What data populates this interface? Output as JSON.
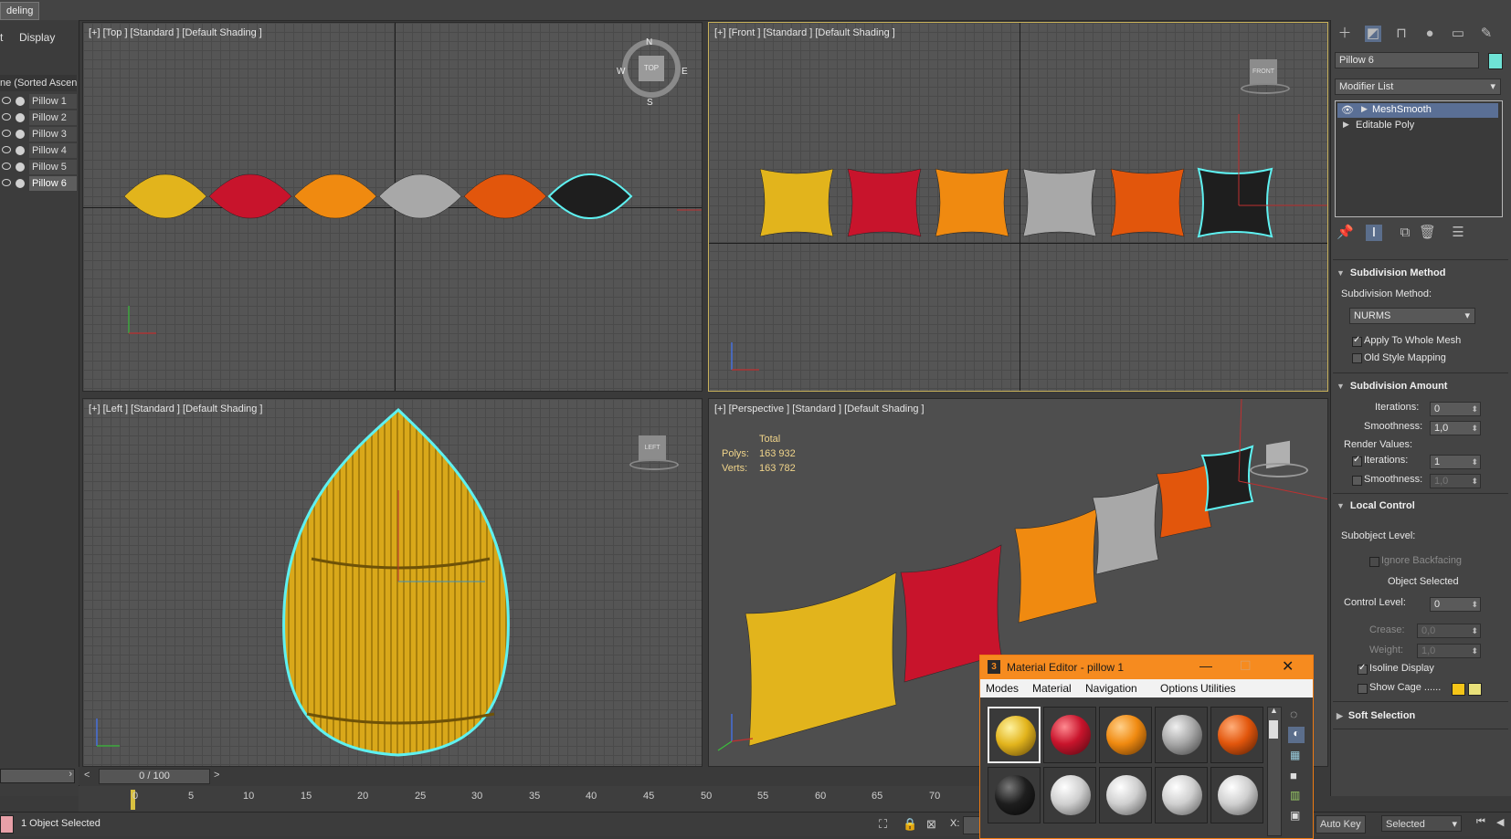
{
  "ribbon": {
    "tab_label": "deling"
  },
  "explorer": {
    "tabs": [
      "t",
      "Display"
    ],
    "sort_header": "ne (Sorted Ascen",
    "items": [
      "Pillow 1",
      "Pillow 2",
      "Pillow 3",
      "Pillow 4",
      "Pillow 5",
      "Pillow 6"
    ],
    "selected": "Pillow 6"
  },
  "viewports": {
    "top": {
      "label": "[+] [Top ] [Standard ] [Default Shading ]",
      "compass": {
        "n": "N",
        "s": "S",
        "e": "E",
        "w": "W",
        "cube": "TOP"
      }
    },
    "front": {
      "label": "[+] [Front ] [Standard ] [Default Shading ]",
      "cube": "FRONT"
    },
    "left": {
      "label": "[+] [Left ] [Standard ] [Default Shading ]",
      "cube": "LEFT"
    },
    "perspective": {
      "label": "[+] [Perspective ] [Standard ] [Default Shading ]",
      "stats": {
        "header": "Total",
        "polys_label": "Polys:",
        "polys": "163 932",
        "verts_label": "Verts:",
        "verts": "163 782"
      }
    }
  },
  "pillow_colors": [
    "#e2b41c",
    "#c8142c",
    "#f08a10",
    "#a8a8a8",
    "#e2560c",
    "#1e1e1e"
  ],
  "command_panel": {
    "object_name": "Pillow 6",
    "object_color": "#6fe3d6",
    "modifier_list": "Modifier List",
    "stack": [
      "MeshSmooth",
      "Editable Poly"
    ],
    "subdivision_method": {
      "title": "Subdivision Method",
      "method_label": "Subdivision Method:",
      "method_value": "NURMS",
      "apply_whole_mesh": "Apply To Whole Mesh",
      "old_style_mapping": "Old Style Mapping"
    },
    "subdivision_amount": {
      "title": "Subdivision Amount",
      "iterations_label": "Iterations:",
      "iterations": "0",
      "smoothness_label": "Smoothness:",
      "smoothness": "1,0",
      "render_values": "Render Values:",
      "render_iterations_label": "Iterations:",
      "render_iterations": "1",
      "render_smoothness_label": "Smoothness:",
      "render_smoothness": "1,0"
    },
    "local_control": {
      "title": "Local Control",
      "subobject_level": "Subobject Level:",
      "ignore_backfacing": "Ignore Backfacing",
      "object_selected": "Object Selected",
      "control_level_label": "Control Level:",
      "control_level": "0",
      "crease_label": "Crease:",
      "crease": "0,0",
      "weight_label": "Weight:",
      "weight": "1,0",
      "isoline_display": "Isoline Display",
      "show_cage": "Show Cage ......",
      "cage_colors": [
        "#f5c518",
        "#e8e07a"
      ]
    },
    "soft_selection": {
      "title": "Soft Selection"
    }
  },
  "material_editor": {
    "title": "Material Editor - pillow 1",
    "menu": [
      "Modes",
      "Material",
      "Navigation",
      "Options",
      "Utilities"
    ],
    "slot_colors_row1": [
      "#e2b41c",
      "#c8142c",
      "#f08a10",
      "#a8a8a8",
      "#e2560c"
    ],
    "slot_colors_row2": [
      "#1e1e1e",
      "#cfcfcf",
      "#cfcfcf",
      "#cfcfcf",
      "#cfcfcf"
    ]
  },
  "timeline": {
    "position": "0 / 100",
    "ticks": [
      "0",
      "5",
      "10",
      "15",
      "20",
      "25",
      "30",
      "35",
      "40",
      "45",
      "50",
      "55",
      "60",
      "65",
      "70"
    ]
  },
  "status": {
    "selection": "1 Object Selected",
    "x_label": "X:",
    "auto_key": "Auto Key",
    "key_filter": "Selected"
  }
}
